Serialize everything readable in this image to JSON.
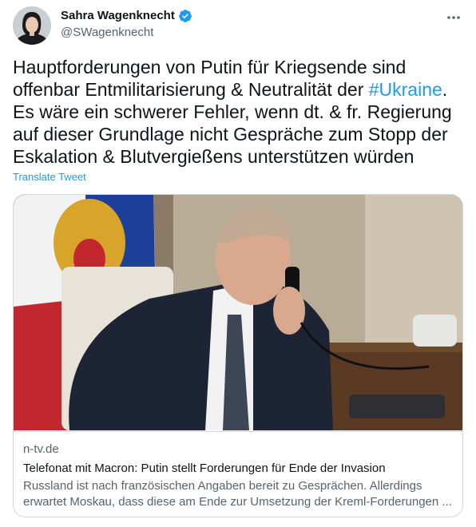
{
  "author": {
    "display_name": "Sahra Wagenknecht",
    "handle": "@SWagenknecht",
    "verified": true
  },
  "tweet": {
    "text_before": "Hauptforderungen von Putin für Kriegsende sind offenbar Entmilitarisierung & Neutralität der ",
    "hashtag": "#Ukraine",
    "text_after": ". Es wäre ein schwerer Fehler, wenn dt. & fr. Regierung auf dieser Grundlage nicht Gespräche zum Stopp der Eskalation & Blutvergießens unterstützen würden",
    "translate_label": "Translate Tweet"
  },
  "link_card": {
    "domain": "n-tv.de",
    "title": "Telefonat mit Macron: Putin stellt Forderungen für Ende der Invasion",
    "description": "Russland ist nach französischen Angaben bereit zu Gesprächen. Allerdings erwartet Moskau, dass diese am Ende zur Umsetzung der Kreml-Forderungen ..."
  },
  "icons": {
    "verified": "verified-badge-icon",
    "more": "more-options-icon"
  },
  "colors": {
    "accent": "#1d9bf0",
    "text": "#0f1419",
    "secondary": "#536471"
  }
}
